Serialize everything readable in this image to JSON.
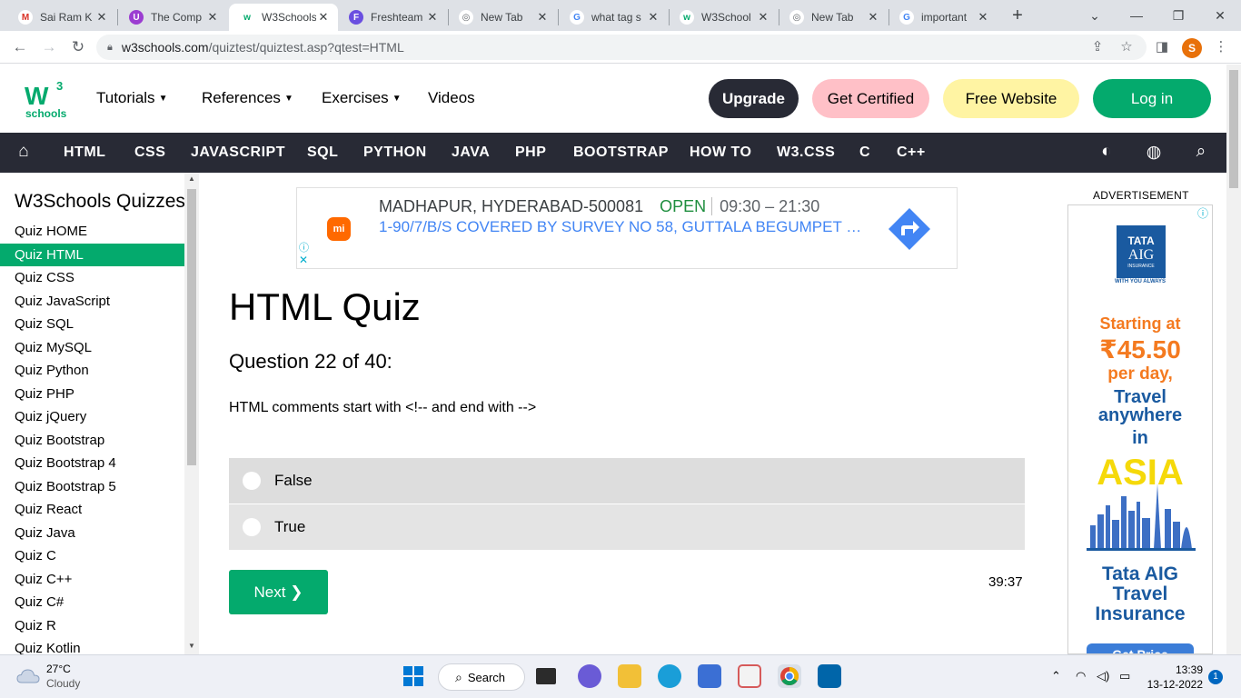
{
  "browser": {
    "tabs": [
      {
        "title": "Sai Ram K",
        "fav_text": "M",
        "fav_color": "#ffffff",
        "fav_fg": "#d93025"
      },
      {
        "title": "The Comp",
        "fav_text": "U",
        "fav_color": "#9b3dd1",
        "fav_fg": "#ffffff"
      },
      {
        "title": "W3Schools",
        "fav_text": "w",
        "fav_color": "#ffffff",
        "fav_fg": "#04aa6d"
      },
      {
        "title": "Freshteam",
        "fav_text": "F",
        "fav_color": "#6a4fe0",
        "fav_fg": "#ffffff"
      },
      {
        "title": "New Tab",
        "fav_text": "◎",
        "fav_color": "#ffffff",
        "fav_fg": "#5f6368"
      },
      {
        "title": "what tag s",
        "fav_text": "G",
        "fav_color": "#ffffff",
        "fav_fg": "#4285f4"
      },
      {
        "title": "W3School",
        "fav_text": "w",
        "fav_color": "#ffffff",
        "fav_fg": "#04aa6d"
      },
      {
        "title": "New Tab",
        "fav_text": "◎",
        "fav_color": "#ffffff",
        "fav_fg": "#5f6368"
      },
      {
        "title": "important",
        "fav_text": "G",
        "fav_color": "#ffffff",
        "fav_fg": "#4285f4"
      }
    ],
    "url_host": "w3schools.com",
    "url_path": "/quiztest/quiztest.asp?qtest=HTML",
    "profile_initial": "S"
  },
  "w3nav": {
    "logo_text": "schools",
    "logo_w": "W",
    "logo_3": "3",
    "items": [
      "Tutorials",
      "References",
      "Exercises",
      "Videos"
    ],
    "upgrade": "Upgrade",
    "get_certified": "Get Certified",
    "free_website": "Free Website",
    "login": "Log in"
  },
  "darkbar": {
    "items": [
      "HTML",
      "CSS",
      "JAVASCRIPT",
      "SQL",
      "PYTHON",
      "JAVA",
      "PHP",
      "BOOTSTRAP",
      "HOW TO",
      "W3.CSS",
      "C",
      "C++"
    ]
  },
  "sidebar": {
    "heading": "W3Schools Quizzes",
    "items": [
      "Quiz HOME",
      "Quiz HTML",
      "Quiz CSS",
      "Quiz JavaScript",
      "Quiz SQL",
      "Quiz MySQL",
      "Quiz Python",
      "Quiz PHP",
      "Quiz jQuery",
      "Quiz Bootstrap",
      "Quiz Bootstrap 4",
      "Quiz Bootstrap 5",
      "Quiz React",
      "Quiz Java",
      "Quiz C",
      "Quiz C++",
      "Quiz C#",
      "Quiz R",
      "Quiz Kotlin"
    ],
    "active_index": 1
  },
  "top_ad": {
    "brand": "mi",
    "line1": "MADHAPUR, HYDERABAD-500081",
    "status": "OPEN",
    "hours": "09:30 – 21:30",
    "line2": "1-90/7/B/S COVERED BY SURVEY NO 58, GUTTALA BEGUMPET VI..."
  },
  "quiz": {
    "title": "HTML Quiz",
    "question_number": "Question 22 of 40:",
    "question_text": "HTML comments start with <!-- and end with -->",
    "options": [
      "False",
      "True"
    ],
    "next_label": "Next ❯",
    "timer": "39:37"
  },
  "right_ad": {
    "label": "ADVERTISEMENT",
    "logo_line1": "TATA",
    "logo_line2": "AIG",
    "logo_line3": "INSURANCE",
    "tagline": "WITH YOU ALWAYS",
    "starting": "Starting at",
    "price": "₹45.50",
    "per_day": "per day,",
    "travel": "Travel",
    "anywhere": "anywhere",
    "in": "in",
    "asia": "ASIA",
    "brand1": "Tata AIG",
    "brand2": "Travel",
    "brand3": "Insurance",
    "cta": "Get Price"
  },
  "taskbar": {
    "temp": "27°C",
    "weather": "Cloudy",
    "search": "Search",
    "time": "13:39",
    "date": "13-12-2022",
    "notifications": "1"
  },
  "colors": {
    "w3_green": "#04aa6d",
    "dark_bar": "#282a35",
    "certified_pink": "#ffc0c7",
    "free_yellow": "#fff4a3",
    "option_bg": "#dddddd"
  }
}
